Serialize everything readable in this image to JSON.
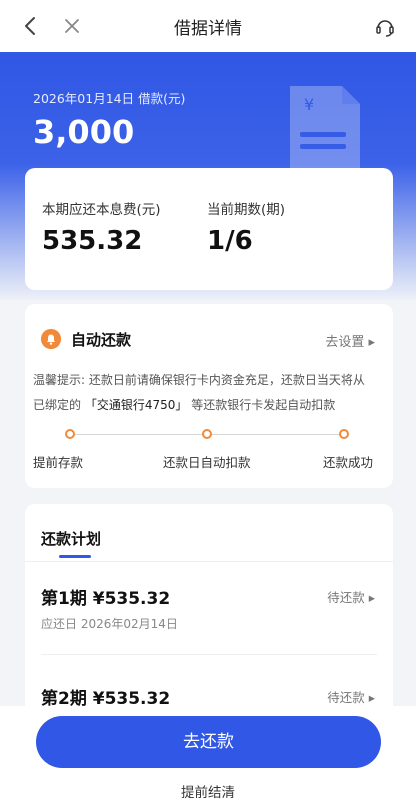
{
  "nav": {
    "title": "借据详情"
  },
  "loan": {
    "date_label": "2026年01月14日 借款(元)",
    "amount": "3,000"
  },
  "current_period": {
    "principal_label": "本期应还本息费(元)",
    "principal_value": "535.32",
    "periods_label": "当前期数(期)",
    "periods_value": "1/6"
  },
  "auto_repay": {
    "title": "自动还款",
    "link": "去设置 ▸",
    "tip_line1": "温馨提示: 还款日前请确保银行卡内资金充足，还款日当天将从",
    "tip_line2_pre": "已绑定的",
    "tip_line2_bank": "「交通银行4750」",
    "tip_line2_post": "等还款银行卡发起自动扣款",
    "steps": [
      "提前存款",
      "还款日自动扣款",
      "还款成功"
    ]
  },
  "plan": {
    "title": "还款计划",
    "items": [
      {
        "title": "第1期 ¥535.32",
        "due": "应还日 2026年02月14日",
        "status": "待还款 ▸"
      },
      {
        "title": "第2期 ¥535.32",
        "status": "待还款 ▸"
      }
    ]
  },
  "actions": {
    "pay_label": "去还款",
    "early_label": "提前结清"
  },
  "colors": {
    "primary": "#3057e5",
    "accent_orange": "#f08a3a"
  }
}
